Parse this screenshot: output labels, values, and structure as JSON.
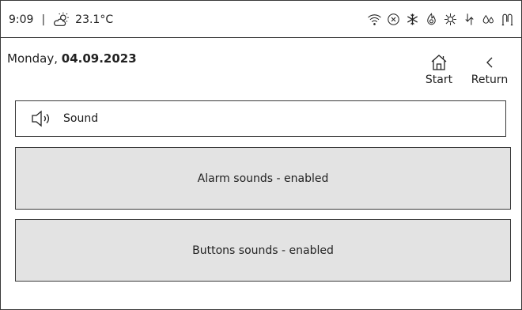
{
  "status_bar": {
    "time": "9:09",
    "separator": "|",
    "weather_icon": "partly-cloudy-icon",
    "temperature": "23.1°C",
    "icons": [
      "wifi-icon",
      "error-circle-icon",
      "snowflake-icon",
      "flame-icon",
      "defrost-icon",
      "pump-icon",
      "water-drops-icon",
      "valve-icon"
    ]
  },
  "header": {
    "day": "Monday,",
    "date": "04.09.2023",
    "start_label": "Start",
    "return_label": "Return"
  },
  "section": {
    "icon": "speaker-icon",
    "title": "Sound"
  },
  "options": [
    {
      "label": "Alarm sounds - enabled"
    },
    {
      "label": "Buttons sounds - enabled"
    }
  ]
}
